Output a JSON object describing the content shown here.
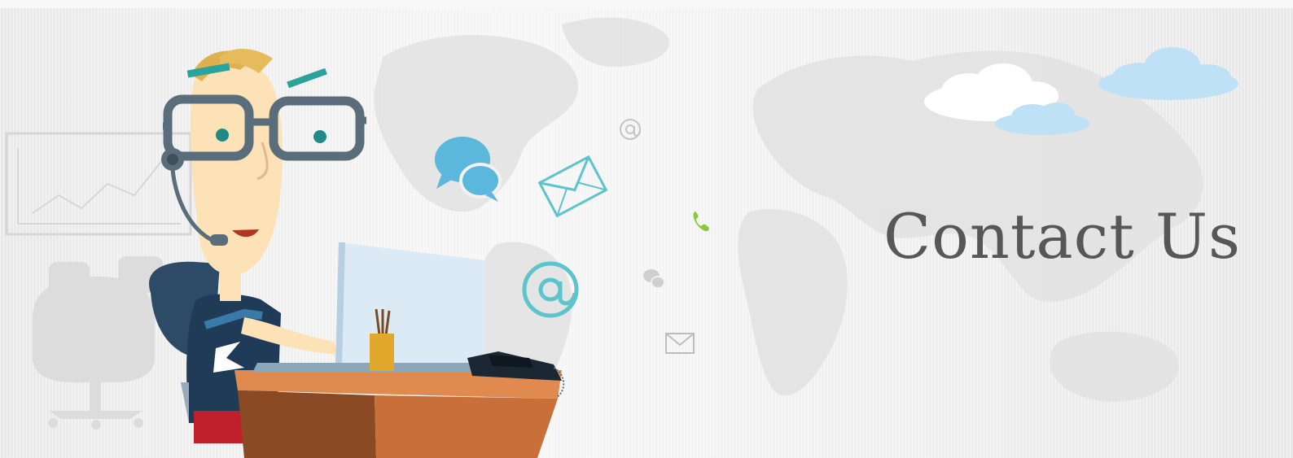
{
  "banner": {
    "headline": "Contact Us"
  },
  "icons": [
    "world-map-background",
    "cloud-icon",
    "customer-support-agent-illustration",
    "headset-icon",
    "laptop-icon",
    "desk-icon",
    "pencil-cup-icon",
    "telephone-icon",
    "chat-bubbles-icon",
    "envelope-icon",
    "at-sign-icon",
    "phone-handset-icon",
    "whiteboard-chart-icon",
    "office-chair-icon"
  ],
  "colors": {
    "headline": "#575757",
    "accent_blue": "#5bb7dc",
    "accent_teal": "#5cc4cc",
    "cloud_blue": "#bfe1f6",
    "phone_green": "#8cc63f",
    "desk_orange": "#c96f3a",
    "shirt_navy": "#1f3b57"
  }
}
